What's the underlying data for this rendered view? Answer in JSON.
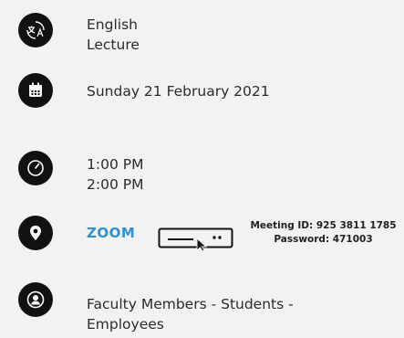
{
  "language": {
    "line1": "English",
    "line2": "Lecture"
  },
  "date": {
    "text": "Sunday 21 February 2021"
  },
  "time": {
    "start": "1:00 PM",
    "end": "2:00 PM"
  },
  "location": {
    "link_label": "ZOOM",
    "meeting_id": "Meeting ID: 925 3811 1785",
    "password": "Password: 471003"
  },
  "audience": {
    "line1": "Faculty Members - Students -",
    "line2": "Employees"
  },
  "icons": {
    "language": "translate-icon",
    "date": "calendar-icon",
    "time": "clock-icon",
    "location": "location-pin-icon",
    "audience": "user-circle-icon",
    "device": "computer-click-icon"
  },
  "colors": {
    "accent": "#2f8fd6",
    "icon_bg": "#111111",
    "background": "#f2f2f2"
  }
}
